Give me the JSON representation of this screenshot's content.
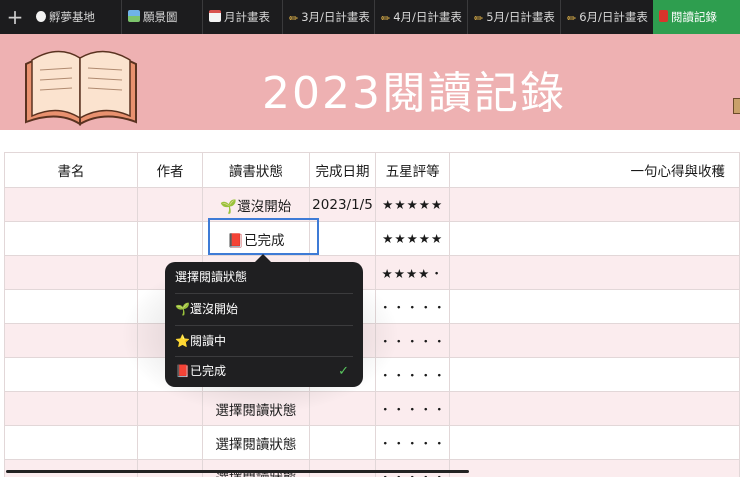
{
  "tabbar": {
    "plus_label": "+",
    "tabs": [
      {
        "label": "孵夢基地",
        "icon": "egg-icon"
      },
      {
        "label": "願景圖",
        "icon": "picture-icon"
      },
      {
        "label": "月計畫表",
        "icon": "calendar-icon"
      },
      {
        "label": "3月/日計畫表",
        "icon": "pencil-icon"
      },
      {
        "label": "4月/日計畫表",
        "icon": "pencil-icon"
      },
      {
        "label": "5月/日計畫表",
        "icon": "pencil-icon"
      },
      {
        "label": "6月/日計畫表",
        "icon": "pencil-icon"
      },
      {
        "label": "閱讀記錄",
        "icon": "red-book-icon",
        "active": true
      }
    ],
    "active_color": "#2e9e4f"
  },
  "banner": {
    "title": "2023閱讀記錄",
    "background": "#eeb1b2"
  },
  "table": {
    "headers": {
      "book": "書名",
      "author": "作者",
      "status": "讀書狀態",
      "date": "完成日期",
      "rating": "五星評等",
      "review": "一句心得與收穫"
    },
    "rows": [
      {
        "status": "🌱還沒開始",
        "date": "2023/1/5",
        "rating": "★★★★★"
      },
      {
        "status": "📕已完成",
        "date": "",
        "rating": "★★★★★"
      },
      {
        "status": "",
        "date": "",
        "rating": "★★★★・"
      },
      {
        "status": "",
        "date": "",
        "rating": "・・・・・"
      },
      {
        "status": "",
        "date": "",
        "rating": "・・・・・"
      },
      {
        "status": "",
        "date": "",
        "rating": "・・・・・"
      },
      {
        "status": "選擇閱讀狀態",
        "date": "",
        "rating": "・・・・・"
      },
      {
        "status": "選擇閱讀狀態",
        "date": "",
        "rating": "・・・・・"
      },
      {
        "status": "選擇閱讀狀態",
        "date": "",
        "rating": "・・・・・"
      }
    ]
  },
  "popup": {
    "header": "選擇閱讀狀態",
    "options": [
      {
        "label": "🌱還沒開始",
        "checked": false
      },
      {
        "label": "⭐閱讀中",
        "checked": false
      },
      {
        "label": "📕已完成",
        "checked": true
      }
    ],
    "check_mark": "✓"
  }
}
